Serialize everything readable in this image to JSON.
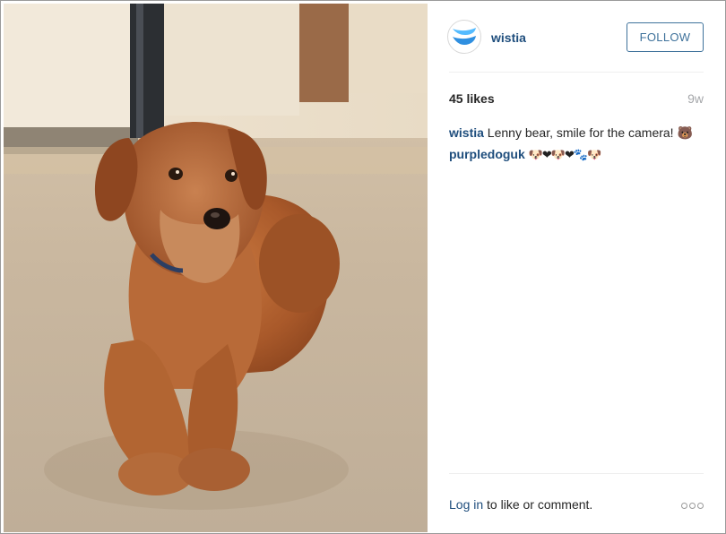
{
  "post": {
    "username": "wistia",
    "follow_label": "FOLLOW",
    "likes": "45 likes",
    "age": "9w",
    "comments": [
      {
        "user": "wistia",
        "text": "Lenny bear, smile for the camera! 🐻"
      },
      {
        "user": "purpledoguk",
        "text": "🐶❤🐶❤🐾🐶"
      }
    ],
    "footer": {
      "login_link": "Log in",
      "login_suffix": " to like or comment."
    }
  },
  "photo": {
    "subject": "dog-photo"
  },
  "colors": {
    "link": "#1f4e7d",
    "follow_border": "#3f729b",
    "muted": "#a5a7aa",
    "brand_blue": "#54bbff"
  },
  "icons": {
    "avatar": "wistia-logo-icon",
    "more": "more-options-icon"
  }
}
